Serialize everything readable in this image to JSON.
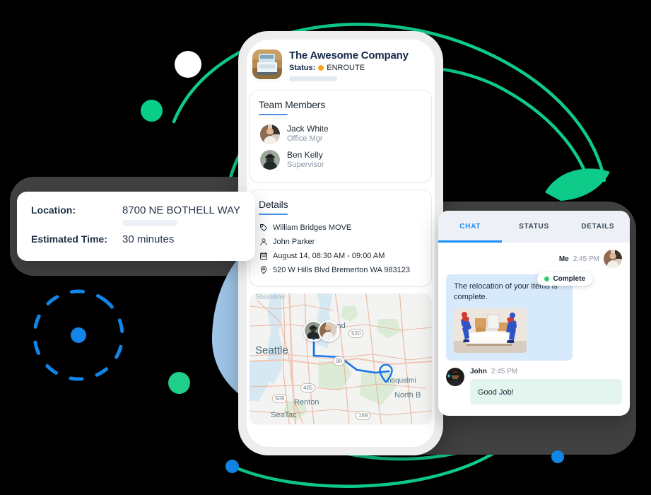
{
  "phone": {
    "company": {
      "name": "The Awesome Company",
      "status_label": "Status:",
      "status_value": "ENROUTE",
      "status_color": "#F5A623",
      "logo_icon": "truck-photo"
    },
    "team_card": {
      "title": "Team Members",
      "members": [
        {
          "name": "Jack White",
          "role": "Office Mgr",
          "avatar_icon": "avatar-jack-white"
        },
        {
          "name": "Ben Kelly",
          "role": "Supervisor",
          "avatar_icon": "avatar-ben-kelly"
        }
      ]
    },
    "details_card": {
      "title": "Details",
      "rows": [
        {
          "icon": "tag-icon",
          "text": "William Bridges MOVE"
        },
        {
          "icon": "person-icon",
          "text": "John Parker"
        },
        {
          "icon": "calendar-icon",
          "text": "August 14, 08:30 AM - 09:00 AM"
        },
        {
          "icon": "location-pin-icon",
          "text": "520 W Hills Blvd Bremerton WA 983123"
        }
      ]
    },
    "map": {
      "labels": {
        "shoreline": "Shoreline",
        "seattle": "Seattle",
        "redmond": "Redmond",
        "renton": "Renton",
        "seatac": "SeaTac",
        "snoqualmie": "noqualmi",
        "northbend": "North B"
      },
      "shields": {
        "i90": "90",
        "i405": "405",
        "r509": "509",
        "r169": "169",
        "r520": "520"
      },
      "route_color": "#1A73E8",
      "pin_icon": "map-pin-icon"
    }
  },
  "location_card": {
    "location_label": "Location:",
    "location_value": "8700 NE BOTHELL WAY",
    "time_label": "Estimated Time:",
    "time_value": "30 minutes"
  },
  "chat_card": {
    "tabs": [
      {
        "label": "CHAT",
        "active": true
      },
      {
        "label": "STATUS",
        "active": false
      },
      {
        "label": "DETAILS",
        "active": false
      }
    ],
    "accent_color": "#1A8CFF",
    "messages": [
      {
        "sender": "Me",
        "time": "2:45 PM",
        "badge": "Complete",
        "badge_dot_color": "#2ECC71",
        "text": "The relocation of your items is complete.",
        "photo_icon": "movers-sofa-photo",
        "avatar_icon": "avatar-me"
      },
      {
        "sender": "John",
        "time": "2:45 PM",
        "text": "Good Job!",
        "avatar_icon": "avatar-john"
      }
    ]
  },
  "decorations": {
    "green": "#0FCB8A",
    "blue": "#1186E8",
    "dark_panel": "#414141",
    "pale_blue": "#A9D2F5"
  }
}
